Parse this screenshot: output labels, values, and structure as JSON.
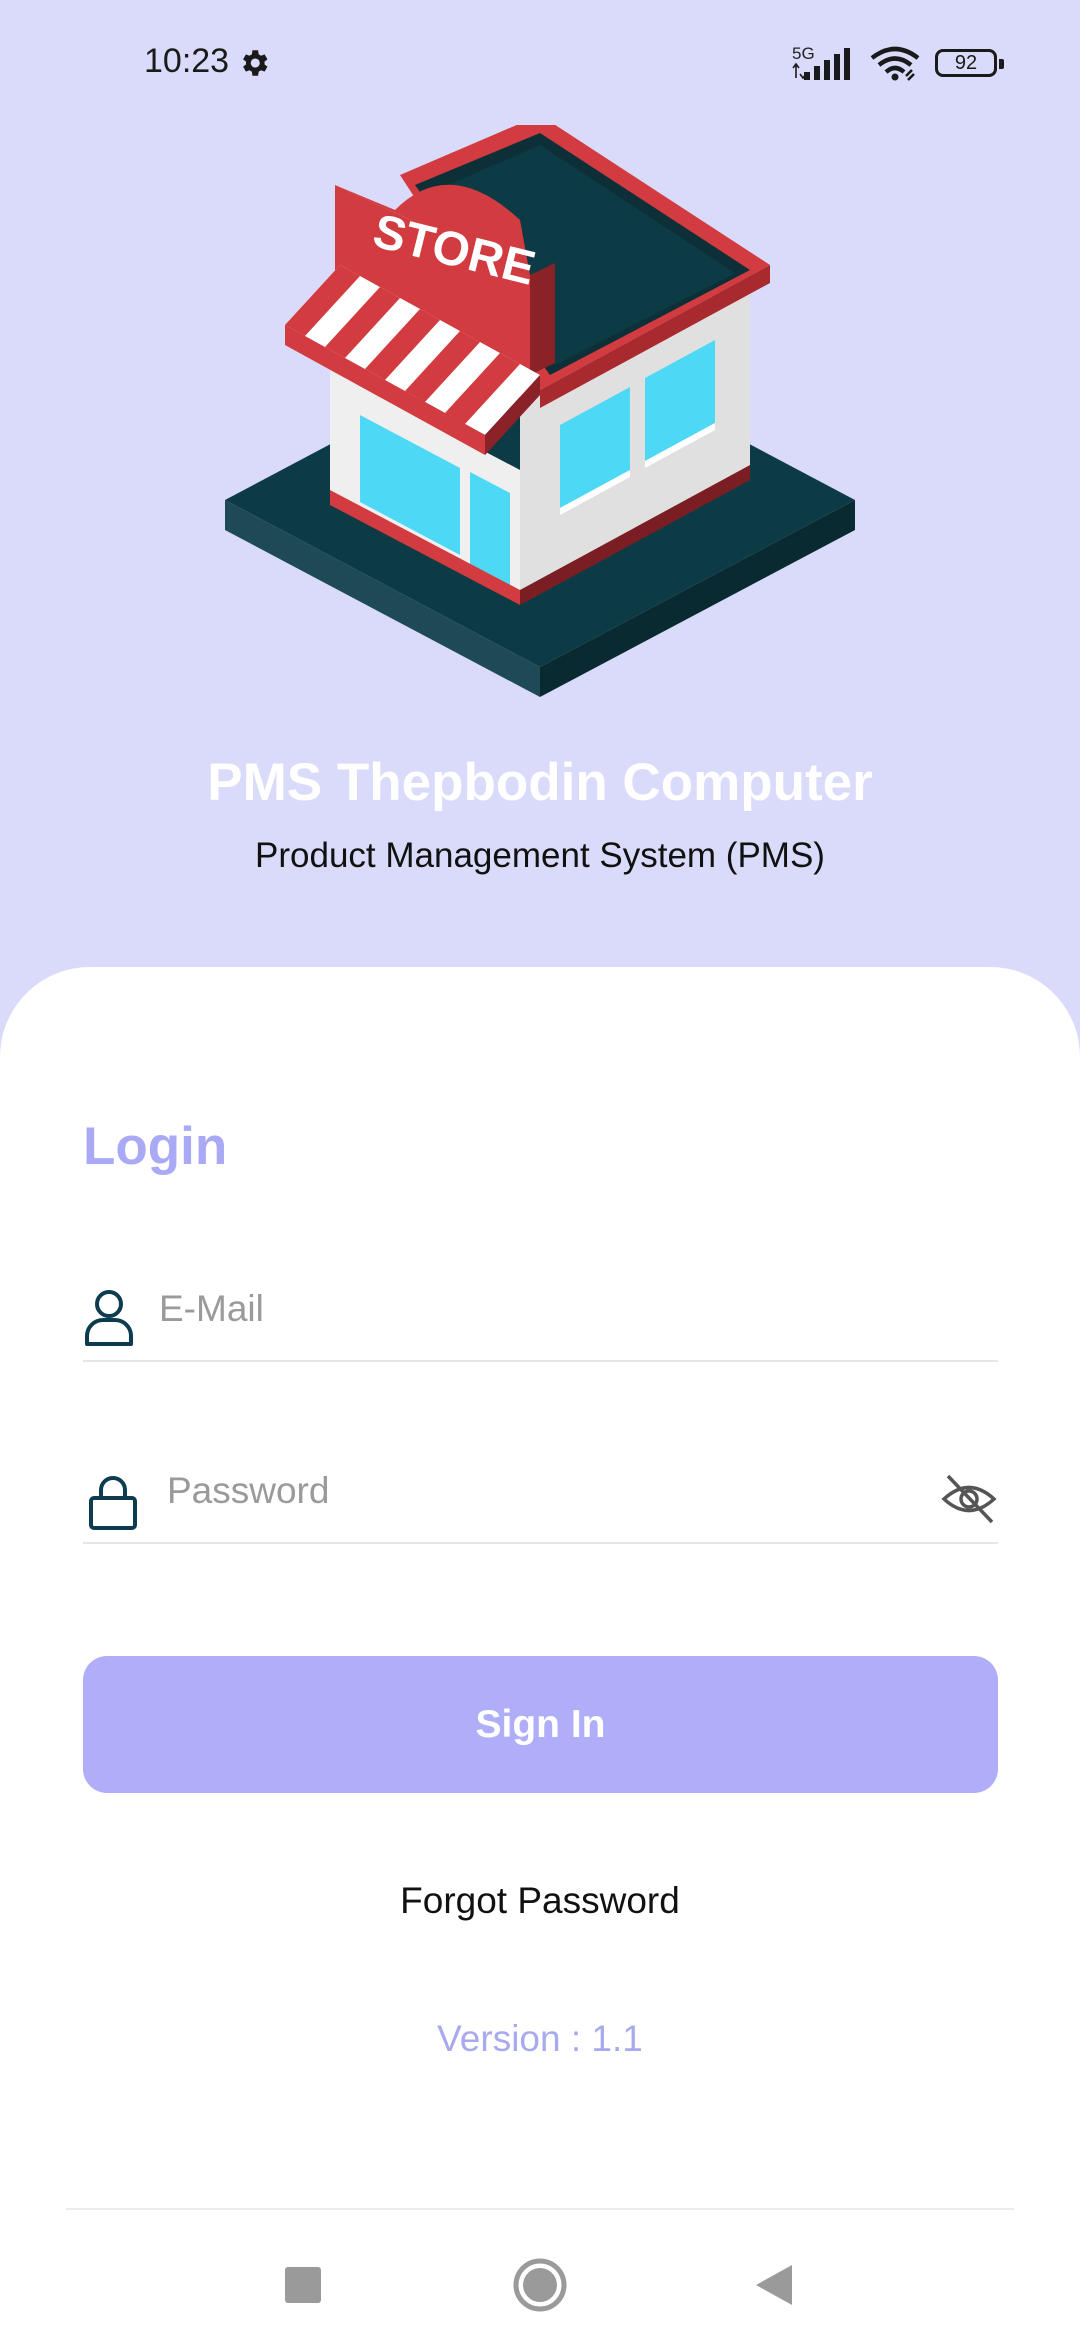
{
  "status_bar": {
    "time": "10:23",
    "network": "5G",
    "battery": "92",
    "icons": [
      "gear-icon",
      "signal-icon",
      "wifi-icon",
      "battery-icon"
    ]
  },
  "header": {
    "store_sign": "STORE",
    "title": "PMS Thepbodin Computer",
    "subtitle": "Product Management System (PMS)"
  },
  "login": {
    "heading": "Login",
    "email_placeholder": "E-Mail",
    "password_placeholder": "Password",
    "signin_label": "Sign In",
    "forgot_label": "Forgot Password",
    "version": "Version : 1.1"
  },
  "nav": {
    "icons": [
      "recents-square-icon",
      "home-circle-icon",
      "back-triangle-icon"
    ]
  },
  "colors": {
    "background": "#dadafa",
    "accent": "#a9a9f5",
    "button": "#b0aef9",
    "icon_dark": "#0d3b4f"
  }
}
